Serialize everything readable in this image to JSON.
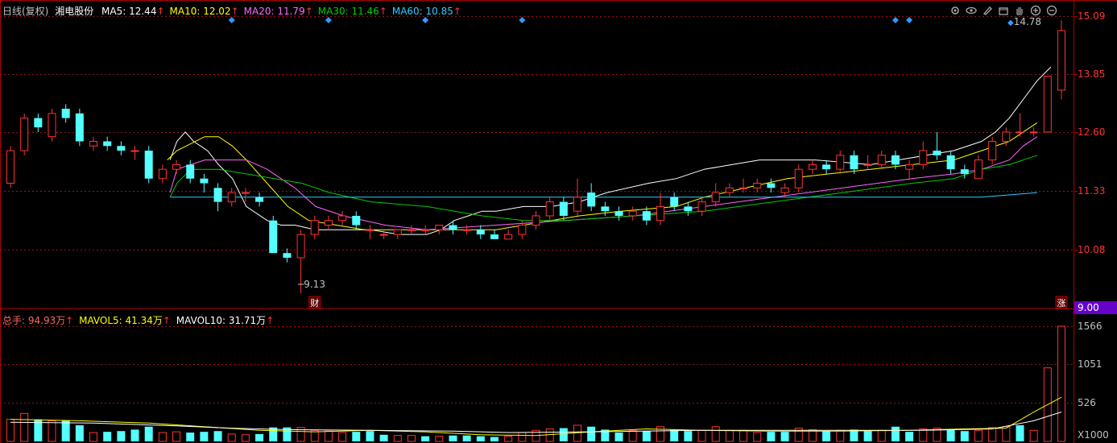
{
  "header": {
    "period": "日线(复权)",
    "stock_name": "湘电股份",
    "ma": [
      {
        "label": "MA5: 12.44",
        "arrow": "↑",
        "color": "#ffffff"
      },
      {
        "label": "MA10: 12.02",
        "arrow": "↑",
        "color": "#ffff00"
      },
      {
        "label": "MA20: 11.79",
        "arrow": "↑",
        "color": "#ff66ff"
      },
      {
        "label": "MA30: 11.46",
        "arrow": "↑",
        "color": "#00cc00"
      },
      {
        "label": "MA60: 10.85",
        "arrow": "↑",
        "color": "#33ccff"
      }
    ]
  },
  "toolbar": {
    "icons": [
      "gear-icon",
      "eye-icon",
      "pen-icon",
      "box-icon",
      "hand-icon",
      "zoom-in-icon",
      "zoom-out-icon"
    ]
  },
  "price_axis": {
    "ticks": [
      "15.09",
      "13.85",
      "12.60",
      "11.33",
      "10.08"
    ],
    "bottom_label": "9.00",
    "bottom_bg": "#6600cc"
  },
  "annotations": {
    "high_label": "14.78",
    "low_label": "9.13",
    "marker_cai": "财",
    "marker_zhang": "涨"
  },
  "volume_header": {
    "total_label": "总手: 94.93万",
    "total_arrow": "↑",
    "mavol5_label": "MAVOL5: 41.34万",
    "mavol5_arrow": "↑",
    "mavol10_label": "MAVOL10: 31.71万",
    "mavol10_arrow": "↑"
  },
  "volume_axis": {
    "ticks": [
      "1566",
      "1051",
      "526"
    ],
    "unit": "X1000"
  },
  "colors": {
    "up": "#ff3333",
    "down": "#54ffff",
    "grid": "#991111",
    "ma5": "#ffffff",
    "ma10": "#ffff00",
    "ma20": "#ff66ff",
    "ma30": "#00cc00",
    "ma60": "#33ccff",
    "marker": "#3399ff"
  },
  "chart_data": {
    "type": "candlestick",
    "ylim": [
      9.0,
      15.09
    ],
    "candles": [
      [
        11.5,
        12.2,
        12.3,
        11.4
      ],
      [
        12.2,
        12.9,
        13.0,
        12.1
      ],
      [
        12.9,
        12.7,
        13.0,
        12.6
      ],
      [
        12.5,
        13.0,
        13.1,
        12.4
      ],
      [
        13.1,
        12.9,
        13.2,
        12.8
      ],
      [
        13.0,
        12.4,
        13.1,
        12.3
      ],
      [
        12.3,
        12.4,
        12.5,
        12.2
      ],
      [
        12.4,
        12.3,
        12.5,
        12.2
      ],
      [
        12.3,
        12.2,
        12.4,
        12.1
      ],
      [
        12.2,
        12.2,
        12.3,
        12.0
      ],
      [
        12.2,
        11.6,
        12.3,
        11.5
      ],
      [
        11.6,
        11.8,
        11.9,
        11.5
      ],
      [
        11.8,
        11.9,
        12.0,
        11.7
      ],
      [
        11.9,
        11.6,
        12.0,
        11.5
      ],
      [
        11.6,
        11.5,
        11.7,
        11.3
      ],
      [
        11.4,
        11.1,
        11.5,
        10.9
      ],
      [
        11.1,
        11.3,
        11.4,
        11.0
      ],
      [
        11.3,
        11.3,
        11.4,
        11.1
      ],
      [
        11.2,
        11.1,
        11.3,
        11.0
      ],
      [
        10.7,
        10.0,
        10.8,
        10.0
      ],
      [
        10.0,
        9.9,
        10.1,
        9.8
      ],
      [
        9.9,
        10.4,
        10.5,
        9.13
      ],
      [
        10.4,
        10.7,
        10.8,
        10.3
      ],
      [
        10.6,
        10.7,
        10.8,
        10.5
      ],
      [
        10.7,
        10.8,
        10.9,
        10.6
      ],
      [
        10.8,
        10.6,
        10.9,
        10.5
      ],
      [
        10.5,
        10.5,
        10.6,
        10.3
      ],
      [
        10.4,
        10.4,
        10.5,
        10.3
      ],
      [
        10.4,
        10.5,
        10.5,
        10.3
      ],
      [
        10.5,
        10.5,
        10.6,
        10.4
      ],
      [
        10.5,
        10.5,
        10.6,
        10.4
      ],
      [
        10.5,
        10.6,
        10.6,
        10.4
      ],
      [
        10.6,
        10.5,
        10.7,
        10.4
      ],
      [
        10.5,
        10.5,
        10.6,
        10.4
      ],
      [
        10.5,
        10.4,
        10.6,
        10.3
      ],
      [
        10.4,
        10.3,
        10.5,
        10.3
      ],
      [
        10.3,
        10.4,
        10.5,
        10.3
      ],
      [
        10.4,
        10.6,
        10.7,
        10.3
      ],
      [
        10.6,
        10.8,
        10.9,
        10.5
      ],
      [
        10.8,
        11.1,
        11.2,
        10.7
      ],
      [
        11.1,
        10.8,
        11.2,
        10.7
      ],
      [
        10.9,
        11.2,
        11.6,
        10.8
      ],
      [
        11.3,
        11.0,
        11.5,
        10.9
      ],
      [
        11.0,
        10.9,
        11.1,
        10.8
      ],
      [
        10.9,
        10.8,
        11.0,
        10.7
      ],
      [
        10.8,
        10.9,
        11.0,
        10.7
      ],
      [
        10.9,
        10.7,
        11.0,
        10.6
      ],
      [
        10.7,
        11.0,
        11.3,
        10.6
      ],
      [
        11.2,
        11.0,
        11.3,
        10.9
      ],
      [
        11.0,
        10.9,
        11.1,
        10.8
      ],
      [
        10.9,
        11.1,
        11.2,
        10.8
      ],
      [
        11.1,
        11.3,
        11.5,
        11.0
      ],
      [
        11.3,
        11.4,
        11.5,
        11.2
      ],
      [
        11.4,
        11.4,
        11.6,
        11.3
      ],
      [
        11.4,
        11.5,
        11.6,
        11.3
      ],
      [
        11.5,
        11.4,
        11.6,
        11.3
      ],
      [
        11.3,
        11.4,
        11.5,
        11.2
      ],
      [
        11.4,
        11.8,
        11.9,
        11.3
      ],
      [
        11.8,
        11.9,
        12.0,
        11.7
      ],
      [
        11.9,
        11.8,
        12.0,
        11.7
      ],
      [
        11.8,
        12.1,
        12.2,
        11.7
      ],
      [
        12.1,
        11.8,
        12.2,
        11.7
      ],
      [
        11.9,
        11.9,
        12.1,
        11.8
      ],
      [
        11.9,
        12.1,
        12.2,
        11.8
      ],
      [
        12.1,
        11.9,
        12.2,
        11.8
      ],
      [
        11.8,
        11.9,
        12.0,
        11.6
      ],
      [
        11.9,
        12.2,
        12.4,
        11.8
      ],
      [
        12.2,
        12.1,
        12.6,
        12.0
      ],
      [
        12.1,
        11.8,
        12.2,
        11.7
      ],
      [
        11.8,
        11.7,
        11.9,
        11.6
      ],
      [
        11.6,
        12.0,
        12.1,
        11.6
      ],
      [
        12.0,
        12.4,
        12.5,
        11.9
      ],
      [
        12.4,
        12.6,
        12.7,
        12.3
      ],
      [
        12.6,
        12.6,
        13.0,
        12.5
      ],
      [
        12.6,
        12.6,
        12.7,
        12.5
      ],
      [
        12.6,
        13.8,
        13.8,
        12.6
      ],
      [
        13.5,
        14.78,
        15.0,
        13.3
      ]
    ],
    "volume": [
      [
        300,
        "up"
      ],
      [
        380,
        "up"
      ],
      [
        300,
        "down"
      ],
      [
        280,
        "up"
      ],
      [
        280,
        "down"
      ],
      [
        220,
        "down"
      ],
      [
        120,
        "up"
      ],
      [
        130,
        "down"
      ],
      [
        140,
        "down"
      ],
      [
        160,
        "down"
      ],
      [
        200,
        "down"
      ],
      [
        120,
        "up"
      ],
      [
        130,
        "up"
      ],
      [
        120,
        "down"
      ],
      [
        130,
        "down"
      ],
      [
        140,
        "down"
      ],
      [
        100,
        "up"
      ],
      [
        90,
        "up"
      ],
      [
        100,
        "down"
      ],
      [
        190,
        "down"
      ],
      [
        190,
        "down"
      ],
      [
        190,
        "up"
      ],
      [
        150,
        "up"
      ],
      [
        140,
        "up"
      ],
      [
        120,
        "up"
      ],
      [
        130,
        "down"
      ],
      [
        140,
        "down"
      ],
      [
        90,
        "down"
      ],
      [
        80,
        "up"
      ],
      [
        80,
        "up"
      ],
      [
        70,
        "down"
      ],
      [
        70,
        "up"
      ],
      [
        80,
        "down"
      ],
      [
        80,
        "down"
      ],
      [
        70,
        "down"
      ],
      [
        60,
        "down"
      ],
      [
        70,
        "up"
      ],
      [
        120,
        "up"
      ],
      [
        150,
        "up"
      ],
      [
        170,
        "up"
      ],
      [
        180,
        "down"
      ],
      [
        220,
        "up"
      ],
      [
        200,
        "down"
      ],
      [
        160,
        "down"
      ],
      [
        120,
        "down"
      ],
      [
        150,
        "up"
      ],
      [
        140,
        "down"
      ],
      [
        200,
        "up"
      ],
      [
        160,
        "down"
      ],
      [
        140,
        "down"
      ],
      [
        150,
        "up"
      ],
      [
        200,
        "up"
      ],
      [
        150,
        "up"
      ],
      [
        150,
        "up"
      ],
      [
        120,
        "up"
      ],
      [
        130,
        "down"
      ],
      [
        130,
        "down"
      ],
      [
        180,
        "up"
      ],
      [
        160,
        "up"
      ],
      [
        140,
        "down"
      ],
      [
        150,
        "up"
      ],
      [
        160,
        "down"
      ],
      [
        140,
        "down"
      ],
      [
        150,
        "up"
      ],
      [
        200,
        "down"
      ],
      [
        130,
        "down"
      ],
      [
        170,
        "up"
      ],
      [
        180,
        "up"
      ],
      [
        160,
        "down"
      ],
      [
        140,
        "down"
      ],
      [
        150,
        "up"
      ],
      [
        190,
        "up"
      ],
      [
        200,
        "up"
      ],
      [
        220,
        "down"
      ],
      [
        150,
        "up"
      ],
      [
        1000,
        "up"
      ],
      [
        1566,
        "up"
      ]
    ],
    "ma_lines": {
      "ma5": [
        [
          12.0,
          11.5
        ],
        [
          12.4,
          12.0
        ],
        [
          12.6,
          12.6
        ],
        [
          12.4,
          13.2
        ],
        [
          12.2,
          14.2
        ],
        [
          11.9,
          15.0
        ],
        [
          11.6,
          16.0
        ],
        [
          11.0,
          17.0
        ],
        [
          10.7,
          18.5
        ],
        [
          10.6,
          19.5
        ],
        [
          10.6,
          20.5
        ],
        [
          10.5,
          22.0
        ],
        [
          10.5,
          24.0
        ],
        [
          10.5,
          26.0
        ],
        [
          10.4,
          28.0
        ],
        [
          10.4,
          30.0
        ],
        [
          10.5,
          31.0
        ],
        [
          10.7,
          32.0
        ],
        [
          10.8,
          33.0
        ],
        [
          10.9,
          34.0
        ],
        [
          10.9,
          35.0
        ],
        [
          11.0,
          37.0
        ],
        [
          11.0,
          39.0
        ],
        [
          11.1,
          41.0
        ],
        [
          11.3,
          43.0
        ],
        [
          11.5,
          46.0
        ],
        [
          11.6,
          48.0
        ],
        [
          11.8,
          50.0
        ],
        [
          11.9,
          52.0
        ],
        [
          12.0,
          54.0
        ],
        [
          12.0,
          58.0
        ],
        [
          11.9,
          62.0
        ],
        [
          12.0,
          64.0
        ],
        [
          12.1,
          66.0
        ],
        [
          12.2,
          68.0
        ],
        [
          12.4,
          70.0
        ],
        [
          12.6,
          71.0
        ],
        [
          12.9,
          72.0
        ],
        [
          13.3,
          73.0
        ],
        [
          13.7,
          74.0
        ],
        [
          14.0,
          75.0
        ]
      ],
      "ma10": [
        [
          12.0,
          11.3
        ],
        [
          12.2,
          12.0
        ],
        [
          12.5,
          14.0
        ],
        [
          12.5,
          15.0
        ],
        [
          12.3,
          16.0
        ],
        [
          12.0,
          17.0
        ],
        [
          11.5,
          18.5
        ],
        [
          11.0,
          20.0
        ],
        [
          10.7,
          21.5
        ],
        [
          10.6,
          23.5
        ],
        [
          10.5,
          25.5
        ],
        [
          10.5,
          29.0
        ],
        [
          10.5,
          33.0
        ],
        [
          10.5,
          35.0
        ],
        [
          10.6,
          37.0
        ],
        [
          10.7,
          39.0
        ],
        [
          10.8,
          41.0
        ],
        [
          10.9,
          44.0
        ],
        [
          11.0,
          48.0
        ],
        [
          11.2,
          50.0
        ],
        [
          11.4,
          53.0
        ],
        [
          11.6,
          56.0
        ],
        [
          11.7,
          59.0
        ],
        [
          11.8,
          62.0
        ],
        [
          11.9,
          65.0
        ],
        [
          12.0,
          68.0
        ],
        [
          12.2,
          70.0
        ],
        [
          12.4,
          72.0
        ],
        [
          12.6,
          73.0
        ],
        [
          12.8,
          74.0
        ]
      ],
      "ma20": [
        [
          11.3,
          11.5
        ],
        [
          11.8,
          12.0
        ],
        [
          12.0,
          14.0
        ],
        [
          12.0,
          15.5
        ],
        [
          12.0,
          17.0
        ],
        [
          11.8,
          18.5
        ],
        [
          11.4,
          20.5
        ],
        [
          11.0,
          22.0
        ],
        [
          10.8,
          24.0
        ],
        [
          10.6,
          27.0
        ],
        [
          10.5,
          30.0
        ],
        [
          10.6,
          35.0
        ],
        [
          10.7,
          40.0
        ],
        [
          10.8,
          45.0
        ],
        [
          11.0,
          50.0
        ],
        [
          11.2,
          55.0
        ],
        [
          11.4,
          60.0
        ],
        [
          11.6,
          65.0
        ],
        [
          11.7,
          68.0
        ],
        [
          11.8,
          70.0
        ],
        [
          12.0,
          72.0
        ],
        [
          12.3,
          73.0
        ],
        [
          12.5,
          74.0
        ]
      ],
      "ma30": [
        [
          11.2,
          11.5
        ],
        [
          11.5,
          12.0
        ],
        [
          11.8,
          13.0
        ],
        [
          11.8,
          15.0
        ],
        [
          11.7,
          17.0
        ],
        [
          11.6,
          19.0
        ],
        [
          11.5,
          21.0
        ],
        [
          11.3,
          23.0
        ],
        [
          11.1,
          26.0
        ],
        [
          11.0,
          30.0
        ],
        [
          10.8,
          34.0
        ],
        [
          10.7,
          37.0
        ],
        [
          10.7,
          40.0
        ],
        [
          10.8,
          45.0
        ],
        [
          10.9,
          50.0
        ],
        [
          11.1,
          55.0
        ],
        [
          11.3,
          60.0
        ],
        [
          11.5,
          65.0
        ],
        [
          11.6,
          68.0
        ],
        [
          11.8,
          70.0
        ],
        [
          11.9,
          72.0
        ],
        [
          12.1,
          74.0
        ]
      ],
      "ma60": [
        [
          11.2,
          11.5
        ],
        [
          11.2,
          12.0
        ],
        [
          11.2,
          20.0
        ],
        [
          11.2,
          30.0
        ],
        [
          11.2,
          40.0
        ],
        [
          11.2,
          50.0
        ],
        [
          11.2,
          60.0
        ],
        [
          11.2,
          70.0
        ],
        [
          11.3,
          74.0
        ]
      ]
    },
    "mavol_lines": {
      "mavol5": [
        [
          300,
          0
        ],
        [
          280,
          5
        ],
        [
          250,
          10
        ],
        [
          200,
          14
        ],
        [
          150,
          18
        ],
        [
          130,
          22
        ],
        [
          150,
          26
        ],
        [
          130,
          30
        ],
        [
          90,
          34
        ],
        [
          80,
          38
        ],
        [
          130,
          42
        ],
        [
          170,
          46
        ],
        [
          150,
          50
        ],
        [
          140,
          55
        ],
        [
          140,
          60
        ],
        [
          150,
          65
        ],
        [
          170,
          69
        ],
        [
          180,
          72
        ],
        [
          400,
          74
        ],
        [
          600,
          76
        ]
      ],
      "mavol10": [
        [
          260,
          0
        ],
        [
          250,
          6
        ],
        [
          210,
          12
        ],
        [
          180,
          16
        ],
        [
          160,
          20
        ],
        [
          150,
          26
        ],
        [
          140,
          32
        ],
        [
          120,
          36
        ],
        [
          130,
          42
        ],
        [
          150,
          50
        ],
        [
          150,
          58
        ],
        [
          150,
          66
        ],
        [
          170,
          71
        ],
        [
          280,
          74
        ],
        [
          400,
          76
        ]
      ]
    },
    "markers_top": [
      16,
      23,
      30,
      37,
      64,
      65
    ],
    "markers_bottom": [
      {
        "index": 22,
        "label": "财"
      },
      {
        "index": 76,
        "label": "涨"
      }
    ]
  }
}
